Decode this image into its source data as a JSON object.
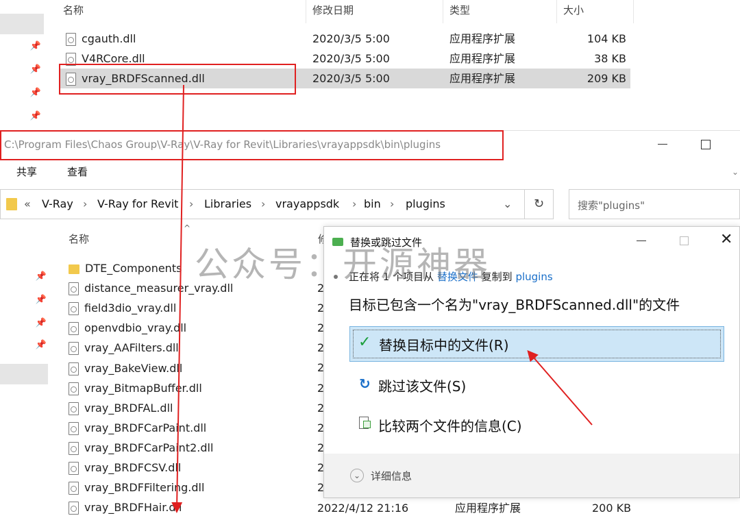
{
  "top_explorer": {
    "columns": {
      "name": "名称",
      "date": "修改日期",
      "type": "类型",
      "size": "大小"
    },
    "files": [
      {
        "name": "cgauth.dll",
        "date": "2020/3/5 5:00",
        "type": "应用程序扩展",
        "size": "104 KB"
      },
      {
        "name": "V4RCore.dll",
        "date": "2020/3/5 5:00",
        "type": "应用程序扩展",
        "size": "38 KB"
      },
      {
        "name": "vray_BRDFScanned.dll",
        "date": "2020/3/5 5:00",
        "type": "应用程序扩展",
        "size": "209 KB"
      }
    ]
  },
  "explorer": {
    "path": "C:\\Program Files\\Chaos Group\\V-Ray\\V-Ray for Revit\\Libraries\\vrayappsdk\\bin\\plugins",
    "menu": [
      "共享",
      "查看"
    ],
    "breadcrumb_prefix": "«",
    "breadcrumb": [
      "V-Ray",
      "V-Ray for Revit",
      "Libraries",
      "vrayappsdk",
      "bin",
      "plugins"
    ],
    "search_placeholder": "搜索\"plugins\"",
    "column_name": "名称",
    "column_date_partial": "修",
    "files": [
      {
        "name": "DTE_Components",
        "kind": "folder"
      },
      {
        "name": "distance_measurer_vray.dll",
        "kind": "dll"
      },
      {
        "name": "field3dio_vray.dll",
        "kind": "dll"
      },
      {
        "name": "openvdbio_vray.dll",
        "kind": "dll"
      },
      {
        "name": "vray_AAFilters.dll",
        "kind": "dll"
      },
      {
        "name": "vray_BakeView.dll",
        "kind": "dll"
      },
      {
        "name": "vray_BitmapBuffer.dll",
        "kind": "dll"
      },
      {
        "name": "vray_BRDFAL.dll",
        "kind": "dll"
      },
      {
        "name": "vray_BRDFCarPaint.dll",
        "kind": "dll"
      },
      {
        "name": "vray_BRDFCarPaint2.dll",
        "kind": "dll"
      },
      {
        "name": "vray_BRDFCSV.dll",
        "kind": "dll"
      },
      {
        "name": "vray_BRDFFiltering.dll",
        "kind": "dll"
      },
      {
        "name": "vray_BRDFHair.dll",
        "kind": "dll"
      }
    ],
    "date_fragment": "2",
    "last_row": {
      "date": "2022/4/12 21:16",
      "type": "应用程序扩展",
      "size": "200 KB"
    }
  },
  "dialog": {
    "title": "替换或跳过文件",
    "status_prefix": "正在将 1 个项目从",
    "source": "替换文件",
    "status_mid": "复制到",
    "dest": "plugins",
    "headline": "目标已包含一个名为\"vray_BRDFScanned.dll\"的文件",
    "options": [
      {
        "label": "替换目标中的文件(R)",
        "icon": "check-icon"
      },
      {
        "label": "跳过该文件(S)",
        "icon": "skip-icon"
      },
      {
        "label": "比较两个文件的信息(C)",
        "icon": "compare-icon"
      }
    ],
    "details": "详细信息"
  },
  "watermark": "公众号：开源神器",
  "accent_red": "#e02020"
}
